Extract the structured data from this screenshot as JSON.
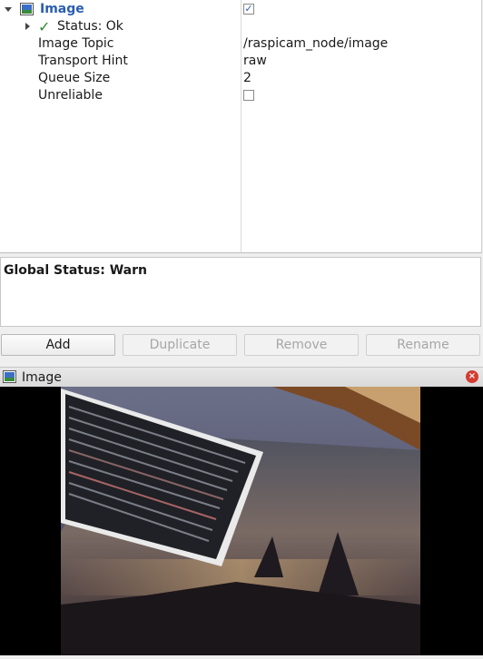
{
  "tree": {
    "rows": [
      {
        "name": "Image",
        "value_checked": true
      },
      {
        "name": "Status: Ok"
      },
      {
        "name": "Image Topic",
        "value": "/raspicam_node/image"
      },
      {
        "name": "Transport Hint",
        "value": "raw"
      },
      {
        "name": "Queue Size",
        "value": "2"
      },
      {
        "name": "Unreliable",
        "value_checked": false
      }
    ]
  },
  "global_status": {
    "label": "Global Status: Warn"
  },
  "buttons": {
    "add": "Add",
    "duplicate": "Duplicate",
    "remove": "Remove",
    "rename": "Rename"
  },
  "image_panel": {
    "title": "Image"
  },
  "icons": {
    "expand": "expand-arrow-icon",
    "collapse": "collapse-arrow-icon",
    "display": "image-display-icon",
    "status_ok": "checkmark-icon",
    "close": "close-icon"
  },
  "colors": {
    "accent": "#2a5db0",
    "status_ok": "#2e8b2e",
    "close": "#d43c32"
  }
}
